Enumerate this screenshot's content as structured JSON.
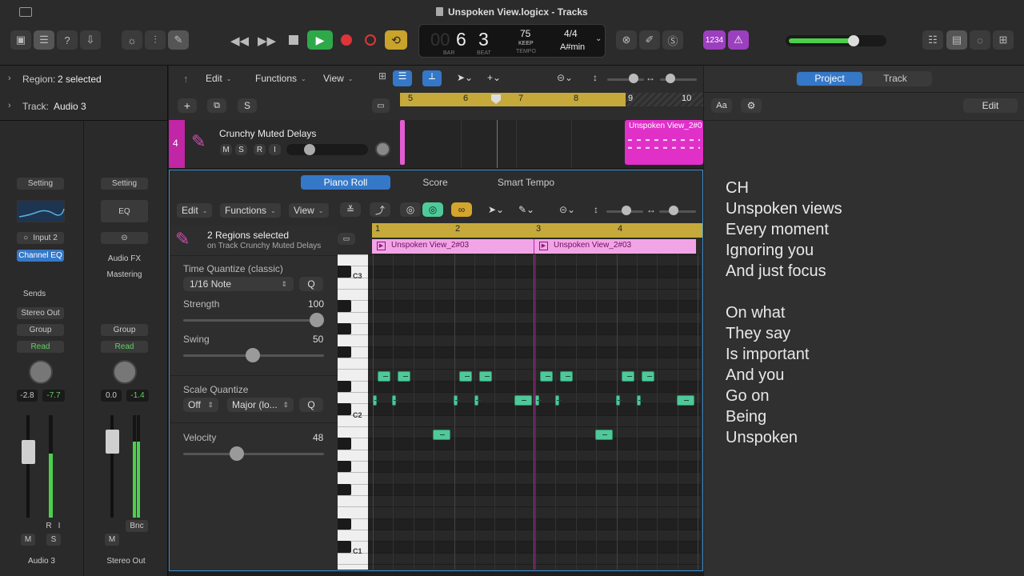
{
  "window": {
    "title": "Unspoken View.logicx - Tracks"
  },
  "lcd": {
    "bar": "6",
    "beat": "3",
    "bar_label": "BAR",
    "beat_label": "BEAT",
    "tempo": "75",
    "keep": "KEEP",
    "tempo_label": "TEMPO",
    "time_sig": "4/4",
    "key": "A#min",
    "bars_dim": "00"
  },
  "toolbar": {
    "counter_badge": "1234"
  },
  "inspector": {
    "region_label": "Region:",
    "region_value": "2 selected",
    "track_label": "Track:",
    "track_value": "Audio 3",
    "strip1": {
      "setting": "Setting",
      "input": "Input 2",
      "eq": "Channel EQ",
      "sends": "Sends",
      "output": "Stereo Out",
      "group": "Group",
      "read": "Read",
      "val1": "-2.8",
      "val2": "-7.7",
      "m": "M",
      "s": "S",
      "r": "R",
      "i": "I",
      "name": "Audio 3"
    },
    "strip2": {
      "setting": "Setting",
      "eq": "EQ",
      "audiofx": "Audio FX",
      "mastering": "Mastering",
      "group": "Group",
      "read": "Read",
      "val1": "0.0",
      "val2": "-1.4",
      "bnc": "Bnc",
      "m": "M",
      "name": "Stereo Out"
    }
  },
  "tracks": {
    "menus": {
      "edit": "Edit",
      "functions": "Functions",
      "view": "View"
    },
    "s_button": "S",
    "ruler": [
      "5",
      "6",
      "7",
      "8",
      "9",
      "10"
    ],
    "track": {
      "number": "4",
      "name": "Crunchy Muted Delays",
      "m": "M",
      "s": "S",
      "r": "R",
      "i": "I",
      "region": "Unspoken View_2#0"
    }
  },
  "editor": {
    "tabs": [
      "Piano Roll",
      "Score",
      "Smart Tempo"
    ],
    "menus": {
      "edit": "Edit",
      "functions": "Functions",
      "view": "View"
    },
    "selection": {
      "title": "2 Regions selected",
      "subtitle": "on Track Crunchy Muted Delays"
    },
    "time_quantize": {
      "label": "Time Quantize (classic)",
      "value": "1/16 Note",
      "q": "Q"
    },
    "strength": {
      "label": "Strength",
      "value": "100",
      "level": 1.0
    },
    "swing": {
      "label": "Swing",
      "value": "50",
      "level": 0.5
    },
    "scale_quantize": {
      "label": "Scale Quantize",
      "off": "Off",
      "scale": "Major (lo...",
      "q": "Q"
    },
    "velocity": {
      "label": "Velocity",
      "value": "48",
      "level": 0.38
    },
    "ruler": [
      "1",
      "2",
      "3",
      "4"
    ],
    "regions": [
      "Unspoken View_2#03",
      "Unspoken View_2#03"
    ],
    "keys": {
      "c3": "C3",
      "c2": "C2",
      "c1": "C1"
    }
  },
  "right": {
    "tabs": {
      "project": "Project",
      "track": "Track"
    },
    "aa": "Aa",
    "edit": "Edit",
    "lyrics": [
      "CH",
      "Unspoken views",
      "Every moment",
      "Ignoring you",
      "And just focus",
      "",
      "On what",
      "They say",
      "Is important",
      "And you",
      "Go on",
      "Being",
      "Unspoken"
    ]
  }
}
